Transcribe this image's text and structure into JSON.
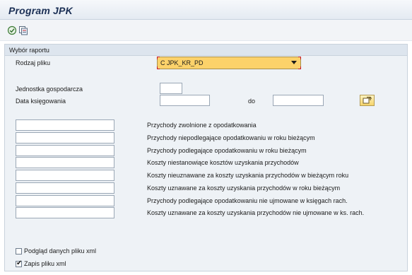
{
  "window": {
    "title": "Program JPK"
  },
  "toolbar": {
    "execute_icon": "execute-icon",
    "variant_icon": "get-variant-icon"
  },
  "section": {
    "header": "Wybór raportu",
    "file_type": {
      "label": "Rodzaj pliku",
      "value": "C JPK_KR_PD"
    }
  },
  "params": {
    "company_code": {
      "label": "Jednostka gospodarcza",
      "value": ""
    },
    "posting_date": {
      "label": "Data księgowania",
      "from": "",
      "to_label": "do",
      "to": ""
    }
  },
  "accounts": [
    {
      "label": "Przychody zwolnione z opodatkowania",
      "value": ""
    },
    {
      "label": "Przychody niepodlegające opodatkowaniu w roku bieżącym",
      "value": ""
    },
    {
      "label": "Przychody podlegające opodatkowaniu w roku bieżącym",
      "value": ""
    },
    {
      "label": "Koszty niestanowiące kosztów uzyskania przychodów",
      "value": ""
    },
    {
      "label": "Koszty nieuznawane za koszty uzyskania przychodów w bieżącym roku",
      "value": ""
    },
    {
      "label": "Koszty uznawane za koszty uzyskania przychodów w roku bieżącym",
      "value": ""
    },
    {
      "label": "Przychody podlegające opodatkowaniu nie ujmowane w księgach rach.",
      "value": ""
    },
    {
      "label": "Koszty uznawane za koszty uzyskania przychodów nie ujmowane w ks. rach.",
      "value": ""
    }
  ],
  "options": {
    "preview": {
      "label": "Podgląd danych pliku xml",
      "checked": false
    },
    "save": {
      "label": "Zapis pliku xml",
      "checked": true
    }
  }
}
